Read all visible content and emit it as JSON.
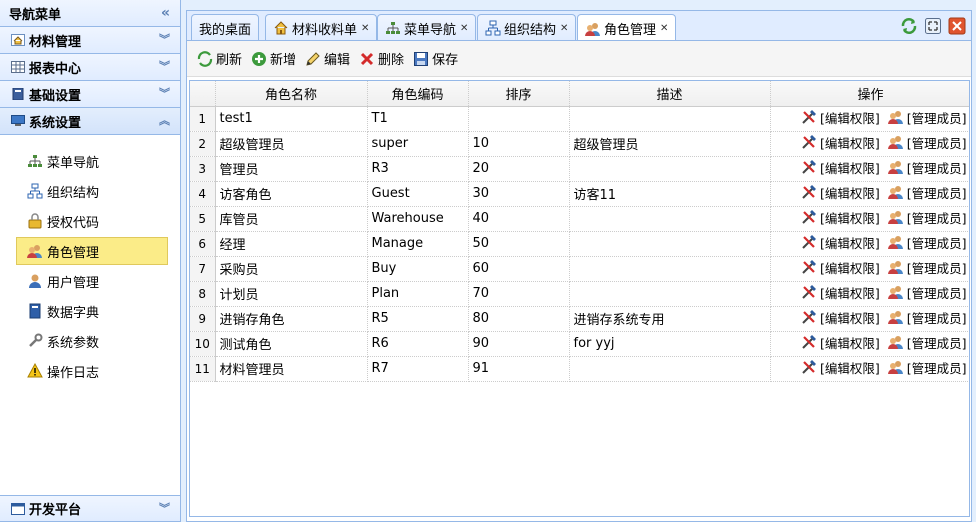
{
  "sidebar": {
    "title": "导航菜单",
    "sections": [
      {
        "label": "材料管理",
        "icon": "home-icon"
      },
      {
        "label": "报表中心",
        "icon": "table-icon"
      },
      {
        "label": "基础设置",
        "icon": "book-icon"
      },
      {
        "label": "系统设置",
        "icon": "monitor-icon"
      }
    ],
    "items": [
      {
        "label": "菜单导航",
        "icon": "sitemap-icon"
      },
      {
        "label": "组织结构",
        "icon": "org-icon"
      },
      {
        "label": "授权代码",
        "icon": "key-lock-icon"
      },
      {
        "label": "角色管理",
        "icon": "users-icon"
      },
      {
        "label": "用户管理",
        "icon": "user-icon"
      },
      {
        "label": "数据字典",
        "icon": "dictionary-icon"
      },
      {
        "label": "系统参数",
        "icon": "wrench-icon"
      },
      {
        "label": "操作日志",
        "icon": "warning-icon"
      }
    ],
    "bottom": {
      "label": "开发平台",
      "icon": "window-icon"
    }
  },
  "tabs": [
    {
      "label": "我的桌面",
      "closable": false
    },
    {
      "label": "材料收料单",
      "closable": true
    },
    {
      "label": "菜单导航",
      "closable": true
    },
    {
      "label": "组织结构",
      "closable": true
    },
    {
      "label": "角色管理",
      "closable": true
    }
  ],
  "toolbar": {
    "refresh": "刷新",
    "add": "新增",
    "edit": "编辑",
    "delete": "删除",
    "save": "保存"
  },
  "grid": {
    "columns": [
      "角色名称",
      "角色编码",
      "排序",
      "描述",
      "操作"
    ],
    "op_edit": "[编辑权限]",
    "op_members": "[管理成员]",
    "rows": [
      {
        "n": "1",
        "name": "test1",
        "code": "T1",
        "sort": "",
        "desc": ""
      },
      {
        "n": "2",
        "name": "超级管理员",
        "code": "super",
        "sort": "10",
        "desc": "超级管理员"
      },
      {
        "n": "3",
        "name": "管理员",
        "code": "R3",
        "sort": "20",
        "desc": ""
      },
      {
        "n": "4",
        "name": "访客角色",
        "code": "Guest",
        "sort": "30",
        "desc": "访客11"
      },
      {
        "n": "5",
        "name": "库管员",
        "code": "Warehouse",
        "sort": "40",
        "desc": ""
      },
      {
        "n": "6",
        "name": "经理",
        "code": "Manage",
        "sort": "50",
        "desc": ""
      },
      {
        "n": "7",
        "name": "采购员",
        "code": "Buy",
        "sort": "60",
        "desc": ""
      },
      {
        "n": "8",
        "name": "计划员",
        "code": "Plan",
        "sort": "70",
        "desc": ""
      },
      {
        "n": "9",
        "name": "进销存角色",
        "code": "R5",
        "sort": "80",
        "desc": "进销存系统专用"
      },
      {
        "n": "10",
        "name": "测试角色",
        "code": "R6",
        "sort": "90",
        "desc": "for yyj"
      },
      {
        "n": "11",
        "name": "材料管理员",
        "code": "R7",
        "sort": "91",
        "desc": ""
      }
    ]
  },
  "colors": {
    "border": "#95b8e7",
    "header_bg": "#e0ecff",
    "active_item": "#fbec88"
  }
}
